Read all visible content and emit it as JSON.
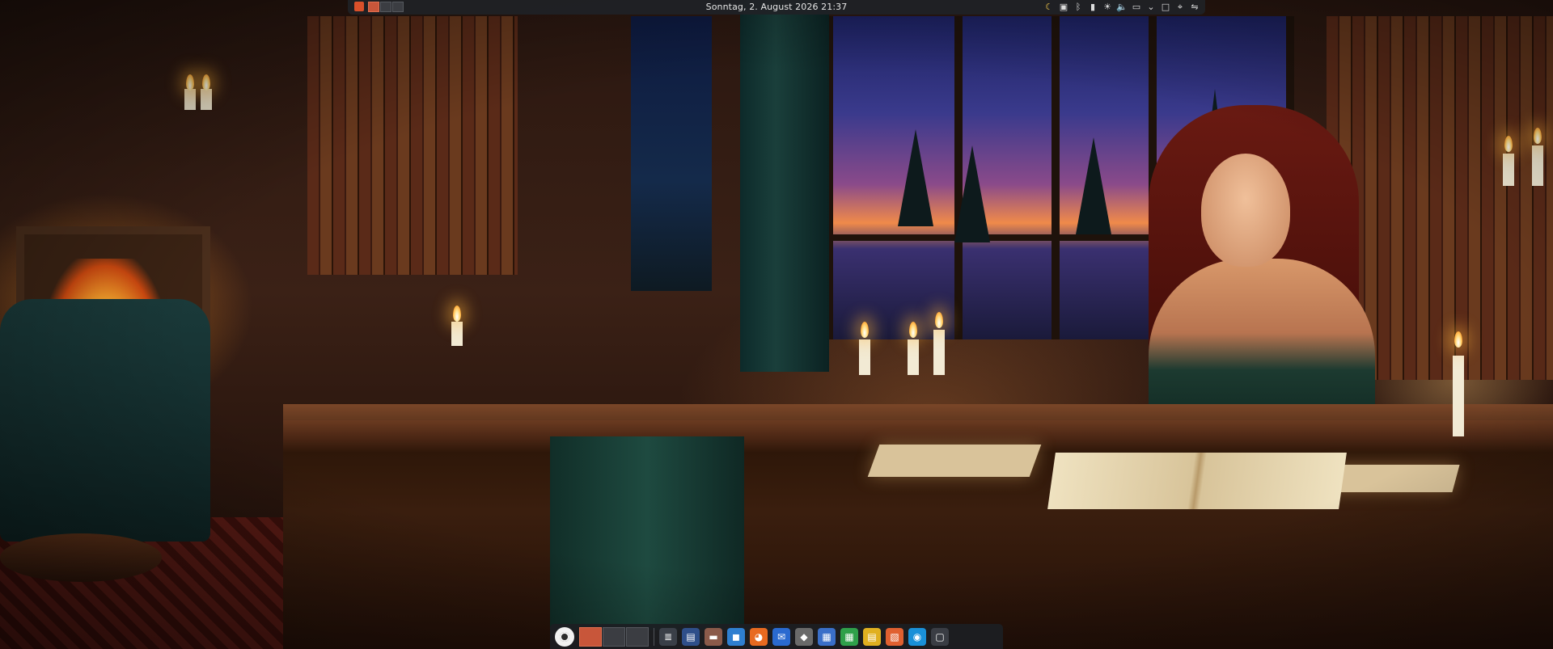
{
  "panel": {
    "clock": "Sonntag, 2. August 2026 21:37",
    "pager": {
      "desktops": [
        {
          "active": true
        },
        {
          "active": false
        },
        {
          "active": false
        }
      ]
    },
    "tray": [
      {
        "name": "night-color-icon",
        "glyph": "☾"
      },
      {
        "name": "clipboard-icon",
        "glyph": "▣"
      },
      {
        "name": "bluetooth-icon",
        "glyph": "ᛒ"
      },
      {
        "name": "battery-icon",
        "glyph": "▮"
      },
      {
        "name": "brightness-icon",
        "glyph": "☀"
      },
      {
        "name": "volume-icon",
        "glyph": "🔈"
      },
      {
        "name": "display-icon",
        "glyph": "▭"
      },
      {
        "name": "expand-tray-icon",
        "glyph": "⌄"
      },
      {
        "name": "show-desktop-icon",
        "glyph": "□"
      },
      {
        "name": "screenshot-icon",
        "glyph": "⌖"
      },
      {
        "name": "network-icon",
        "glyph": "⇋"
      }
    ]
  },
  "dock": {
    "desktops": [
      {
        "active": true
      },
      {
        "active": false
      },
      {
        "active": false
      }
    ],
    "apps": [
      {
        "name": "system-monitor-icon",
        "glyph": "≣",
        "color": "#3a3f48"
      },
      {
        "name": "terminal-icon",
        "glyph": "▤",
        "color": "#2f4f8a"
      },
      {
        "name": "files-icon",
        "glyph": "▬",
        "color": "#8a5a4a"
      },
      {
        "name": "software-store-icon",
        "glyph": "◼",
        "color": "#2f7fd0"
      },
      {
        "name": "firefox-icon",
        "glyph": "◕",
        "color": "#e86a20"
      },
      {
        "name": "thunderbird-icon",
        "glyph": "✉",
        "color": "#2a6ad0"
      },
      {
        "name": "gimp-icon",
        "glyph": "◆",
        "color": "#6a6a6a"
      },
      {
        "name": "document-viewer-icon",
        "glyph": "▦",
        "color": "#3a6fc8"
      },
      {
        "name": "spreadsheet-icon",
        "glyph": "▦",
        "color": "#2fa04a"
      },
      {
        "name": "notes-icon",
        "glyph": "▤",
        "color": "#e0b020"
      },
      {
        "name": "presentation-icon",
        "glyph": "▧",
        "color": "#e06030"
      },
      {
        "name": "chromium-icon",
        "glyph": "◉",
        "color": "#1a90d8"
      },
      {
        "name": "screen-icon",
        "glyph": "▢",
        "color": "#3a3d44"
      }
    ]
  }
}
